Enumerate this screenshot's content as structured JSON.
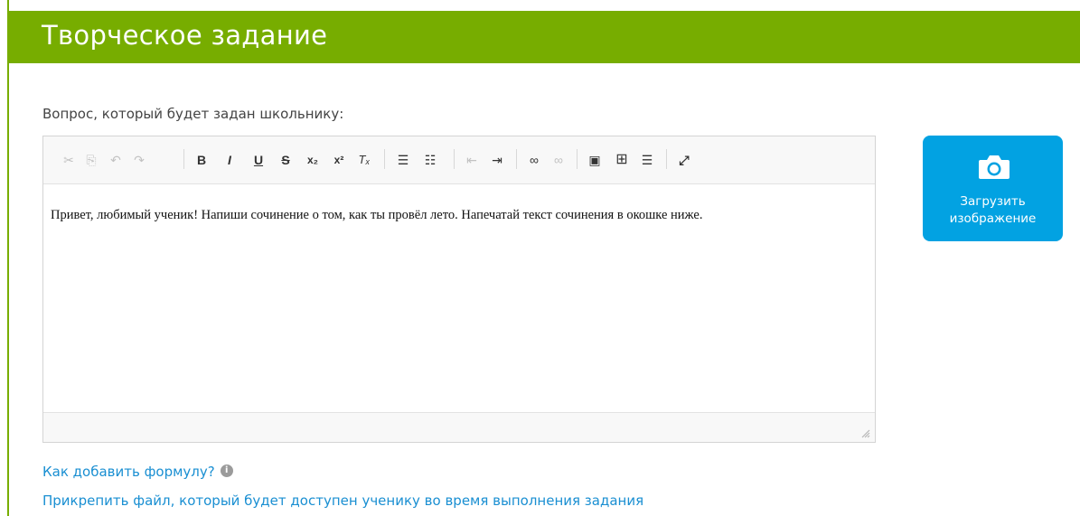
{
  "header": {
    "title": "Творческое задание"
  },
  "form": {
    "question_label": "Вопрос, который будет задан школьнику:"
  },
  "toolbar": {
    "buttons": [
      {
        "name": "cut-icon",
        "glyph": "✂",
        "enabled": false
      },
      {
        "name": "copy-icon",
        "glyph": "⎘",
        "enabled": false
      },
      {
        "name": "undo-icon",
        "glyph": "↶",
        "enabled": false
      },
      {
        "name": "redo-icon",
        "glyph": "↷",
        "enabled": false
      },
      {
        "name": "bold-icon",
        "glyph": "B",
        "enabled": true
      },
      {
        "name": "italic-icon",
        "glyph": "I",
        "enabled": true
      },
      {
        "name": "underline-icon",
        "glyph": "U",
        "enabled": true
      },
      {
        "name": "strikethrough-icon",
        "glyph": "S",
        "enabled": true
      },
      {
        "name": "subscript-icon",
        "glyph": "x₂",
        "enabled": true
      },
      {
        "name": "superscript-icon",
        "glyph": "x²",
        "enabled": true
      },
      {
        "name": "remove-format-icon",
        "glyph": "Tₓ",
        "enabled": true
      },
      {
        "name": "numbered-list-icon",
        "glyph": "☰",
        "enabled": true
      },
      {
        "name": "bulleted-list-icon",
        "glyph": "☷",
        "enabled": true
      },
      {
        "name": "outdent-icon",
        "glyph": "⇤",
        "enabled": false
      },
      {
        "name": "indent-icon",
        "glyph": "⇥",
        "enabled": true
      },
      {
        "name": "link-icon",
        "glyph": "∞",
        "enabled": true
      },
      {
        "name": "unlink-icon",
        "glyph": "∞",
        "enabled": false
      },
      {
        "name": "image-icon",
        "glyph": "▣",
        "enabled": true
      },
      {
        "name": "table-icon",
        "glyph": "⊞",
        "enabled": true
      },
      {
        "name": "horizontal-line-icon",
        "glyph": "☰",
        "enabled": true
      },
      {
        "name": "maximize-icon",
        "glyph": "⤢",
        "enabled": true
      }
    ]
  },
  "editor": {
    "content": "Привет, любимый ученик! Напиши сочинение о том, как ты провёл лето. Напечатай текст сочинения в окошке ниже."
  },
  "upload": {
    "label_line1": "Загрузить",
    "label_line2": "изображение",
    "icon": "camera-icon",
    "color": "#02a2e2"
  },
  "links": {
    "formula_help": "Как добавить формулу?",
    "attach_file": "Прикрепить файл, который будет доступен ученику во время выполнения задания"
  },
  "colors": {
    "header": "#77ad00",
    "link": "#1a8fd2"
  }
}
